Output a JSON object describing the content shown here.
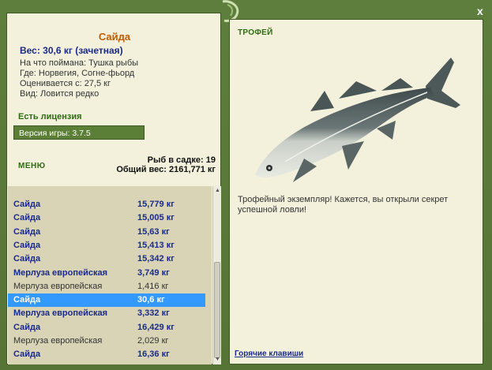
{
  "fish": {
    "name": "Сайда",
    "weight_line": "Вес: 30,6 кг (зачетная)",
    "info": [
      "На что поймана: Тушка рыбы",
      "Где: Норвегия, Согне-фьорд",
      "Оценивается с: 27,5 кг",
      "Вид: Ловится редко"
    ]
  },
  "license": "Есть лицензия",
  "version": "Версия игры: 3.7.5",
  "menu_label": "МЕНЮ",
  "sadok": {
    "count": "Рыб в садке: 19",
    "total": "Общий вес: 2161,771 кг"
  },
  "catch_list": [
    {
      "name": "Сайда",
      "weight": "15,779 кг",
      "style": "bold"
    },
    {
      "name": "Сайда",
      "weight": "15,005 кг",
      "style": "bold"
    },
    {
      "name": "Сайда",
      "weight": "15,63 кг",
      "style": "bold"
    },
    {
      "name": "Сайда",
      "weight": "15,413 кг",
      "style": "bold"
    },
    {
      "name": "Сайда",
      "weight": "15,342 кг",
      "style": "bold"
    },
    {
      "name": "Мерлуза европейская",
      "weight": "3,749 кг",
      "style": "bold"
    },
    {
      "name": "Мерлуза европейская",
      "weight": "1,416 кг",
      "style": "plain"
    },
    {
      "name": "Сайда",
      "weight": "30,6 кг",
      "style": "selected"
    },
    {
      "name": "Мерлуза европейская",
      "weight": "3,332 кг",
      "style": "bold"
    },
    {
      "name": "Сайда",
      "weight": "16,429 кг",
      "style": "bold"
    },
    {
      "name": "Мерлуза европейская",
      "weight": "2,029 кг",
      "style": "plain"
    },
    {
      "name": "Сайда",
      "weight": "16,36 кг",
      "style": "bold"
    }
  ],
  "trophy": {
    "label": "ТРОФЕЙ",
    "text": "Трофейный экземпляр! Кажется, вы открыли секрет успешной ловли!"
  },
  "hotkeys_label": "Горячие клавиши",
  "close_label": "x",
  "colors": {
    "frame_green": "#5a7a3a",
    "panel_bg": "#f3f1dc",
    "title_orange": "#c65a00",
    "text_blue": "#1a2a8a",
    "label_green": "#2e6a12",
    "selection": "#3399ff"
  }
}
